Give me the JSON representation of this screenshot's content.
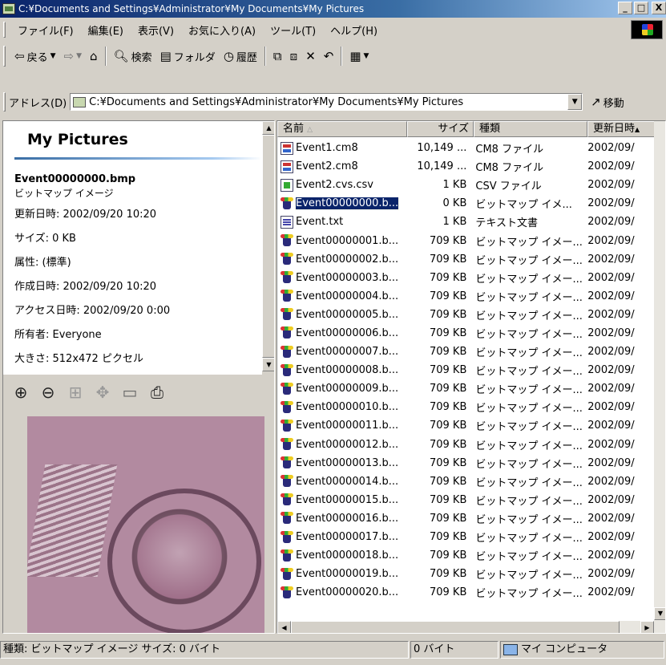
{
  "window": {
    "title": "C:¥Documents and Settings¥Administrator¥My Documents¥My Pictures"
  },
  "title_controls": {
    "minimize": "_",
    "maximize": "□",
    "close": "X"
  },
  "menu": [
    "ファイル(F)",
    "編集(E)",
    "表示(V)",
    "お気に入り(A)",
    "ツール(T)",
    "ヘルプ(H)"
  ],
  "toolbar": {
    "back": "戻る",
    "search": "検索",
    "folders": "フォルダ",
    "history": "履歴"
  },
  "address": {
    "label": "アドレス(D)",
    "value": "C:¥Documents and Settings¥Administrator¥My Documents¥My Pictures",
    "go": "移動"
  },
  "info": {
    "title": "My Pictures",
    "filename": "Event00000000.bmp",
    "filetype": "ビットマップ イメージ",
    "lines": [
      "更新日時: 2002/09/20 10:20",
      "サイズ: 0 KB",
      "属性: (標準)",
      "作成日時: 2002/09/20 10:20",
      "アクセス日時: 2002/09/20 0:00",
      "所有者: Everyone",
      "大きさ: 512x472 ピクセル"
    ]
  },
  "columns": {
    "name": "名前",
    "size": "サイズ",
    "type": "種類",
    "date": "更新日時"
  },
  "files": [
    {
      "icon": "cm8",
      "name": "Event1.cm8",
      "size": "10,149 ...",
      "type": "CM8 ファイル",
      "date": "2002/09/"
    },
    {
      "icon": "cm8",
      "name": "Event2.cm8",
      "size": "10,149 ...",
      "type": "CM8 ファイル",
      "date": "2002/09/"
    },
    {
      "icon": "csv",
      "name": "Event2.cvs.csv",
      "size": "1 KB",
      "type": "CSV ファイル",
      "date": "2002/09/"
    },
    {
      "icon": "bmp",
      "name": "Event00000000.b...",
      "size": "0 KB",
      "type": "ビットマップ イメ...",
      "date": "2002/09/",
      "selected": true
    },
    {
      "icon": "txt",
      "name": "Event.txt",
      "size": "1 KB",
      "type": "テキスト文書",
      "date": "2002/09/"
    },
    {
      "icon": "bmp",
      "name": "Event00000001.b...",
      "size": "709 KB",
      "type": "ビットマップ イメー...",
      "date": "2002/09/"
    },
    {
      "icon": "bmp",
      "name": "Event00000002.b...",
      "size": "709 KB",
      "type": "ビットマップ イメー...",
      "date": "2002/09/"
    },
    {
      "icon": "bmp",
      "name": "Event00000003.b...",
      "size": "709 KB",
      "type": "ビットマップ イメー...",
      "date": "2002/09/"
    },
    {
      "icon": "bmp",
      "name": "Event00000004.b...",
      "size": "709 KB",
      "type": "ビットマップ イメー...",
      "date": "2002/09/"
    },
    {
      "icon": "bmp",
      "name": "Event00000005.b...",
      "size": "709 KB",
      "type": "ビットマップ イメー...",
      "date": "2002/09/"
    },
    {
      "icon": "bmp",
      "name": "Event00000006.b...",
      "size": "709 KB",
      "type": "ビットマップ イメー...",
      "date": "2002/09/"
    },
    {
      "icon": "bmp",
      "name": "Event00000007.b...",
      "size": "709 KB",
      "type": "ビットマップ イメー...",
      "date": "2002/09/"
    },
    {
      "icon": "bmp",
      "name": "Event00000008.b...",
      "size": "709 KB",
      "type": "ビットマップ イメー...",
      "date": "2002/09/"
    },
    {
      "icon": "bmp",
      "name": "Event00000009.b...",
      "size": "709 KB",
      "type": "ビットマップ イメー...",
      "date": "2002/09/"
    },
    {
      "icon": "bmp",
      "name": "Event00000010.b...",
      "size": "709 KB",
      "type": "ビットマップ イメー...",
      "date": "2002/09/"
    },
    {
      "icon": "bmp",
      "name": "Event00000011.b...",
      "size": "709 KB",
      "type": "ビットマップ イメー...",
      "date": "2002/09/"
    },
    {
      "icon": "bmp",
      "name": "Event00000012.b...",
      "size": "709 KB",
      "type": "ビットマップ イメー...",
      "date": "2002/09/"
    },
    {
      "icon": "bmp",
      "name": "Event00000013.b...",
      "size": "709 KB",
      "type": "ビットマップ イメー...",
      "date": "2002/09/"
    },
    {
      "icon": "bmp",
      "name": "Event00000014.b...",
      "size": "709 KB",
      "type": "ビットマップ イメー...",
      "date": "2002/09/"
    },
    {
      "icon": "bmp",
      "name": "Event00000015.b...",
      "size": "709 KB",
      "type": "ビットマップ イメー...",
      "date": "2002/09/"
    },
    {
      "icon": "bmp",
      "name": "Event00000016.b...",
      "size": "709 KB",
      "type": "ビットマップ イメー...",
      "date": "2002/09/"
    },
    {
      "icon": "bmp",
      "name": "Event00000017.b...",
      "size": "709 KB",
      "type": "ビットマップ イメー...",
      "date": "2002/09/"
    },
    {
      "icon": "bmp",
      "name": "Event00000018.b...",
      "size": "709 KB",
      "type": "ビットマップ イメー...",
      "date": "2002/09/"
    },
    {
      "icon": "bmp",
      "name": "Event00000019.b...",
      "size": "709 KB",
      "type": "ビットマップ イメー...",
      "date": "2002/09/"
    },
    {
      "icon": "bmp",
      "name": "Event00000020.b...",
      "size": "709 KB",
      "type": "ビットマップ イメー...",
      "date": "2002/09/"
    }
  ],
  "status": {
    "left": "種類: ビットマップ イメージ サイズ: 0 バイト",
    "size": "0 バイト",
    "zone": "マイ コンピュータ"
  }
}
